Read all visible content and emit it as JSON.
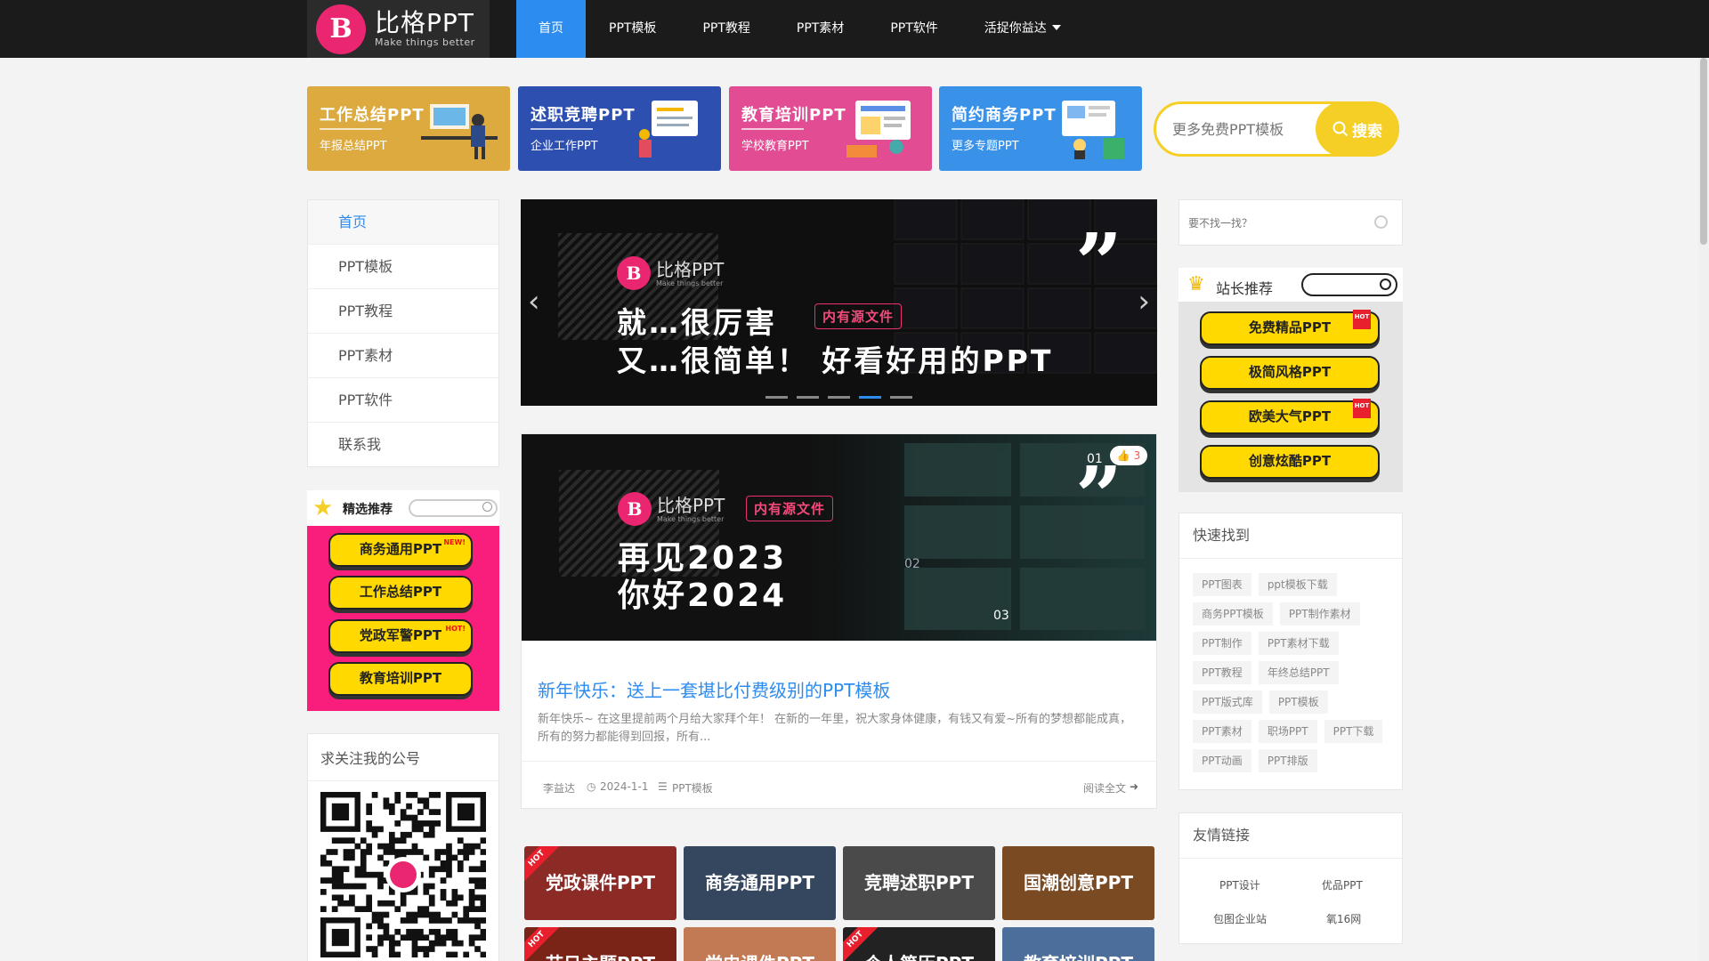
{
  "logo": {
    "name": "比格PPT",
    "tagline": "Make things better",
    "mark": "B"
  },
  "nav": [
    {
      "label": "首页"
    },
    {
      "label": "PPT模板"
    },
    {
      "label": "PPT教程"
    },
    {
      "label": "PPT素材"
    },
    {
      "label": "PPT软件"
    },
    {
      "label": "活捉你益达"
    }
  ],
  "categories": [
    {
      "title": "工作总结PPT",
      "sub": "年报总结PPT",
      "color": "#dcaa3f"
    },
    {
      "title": "述职竞聘PPT",
      "sub": "企业工作PPT",
      "color": "#2d4fb0"
    },
    {
      "title": "教育培训PPT",
      "sub": "学校教育PPT",
      "color": "#e24c93"
    },
    {
      "title": "简约商务PPT",
      "sub": "更多专题PPT",
      "color": "#3a91e8"
    }
  ],
  "search": {
    "placeholder": "更多免费PPT模板",
    "button": "搜索"
  },
  "side_menu": [
    {
      "label": "首页"
    },
    {
      "label": "PPT模板"
    },
    {
      "label": "PPT教程"
    },
    {
      "label": "PPT素材"
    },
    {
      "label": "PPT软件"
    },
    {
      "label": "联系我"
    }
  ],
  "picks": {
    "title": "精选推荐",
    "items": [
      {
        "label": "商务通用PPT",
        "badge": "NEW!"
      },
      {
        "label": "工作总结PPT",
        "badge": ""
      },
      {
        "label": "党政军警PPT",
        "badge": "HOT!"
      },
      {
        "label": "教育培训PPT",
        "badge": ""
      }
    ]
  },
  "qr": {
    "title": "求关注我的公号"
  },
  "hero": {
    "brand": "比格PPT",
    "brand_sub": "Make things better",
    "tag": "内有源文件",
    "line1": "就…很厉害",
    "line2": "又…很简单！ 好看好用的PPT",
    "slides": 5,
    "active_slide": 4
  },
  "post": {
    "brand": "比格PPT",
    "brand_sub": "Make things better",
    "tag": "内有源文件",
    "line1": "再见2023",
    "line2": "你好2024",
    "likes": "3",
    "num1": "01",
    "num2": "02",
    "num3": "03",
    "title": "新年快乐：送上一套堪比付费级别的PPT模板",
    "excerpt": "新年快乐~ 在这里提前两个月给大家拜个年！ 在新的一年里，祝大家身体健康，有钱又有爱~所有的梦想都能成真，所有的努力都能得到回报，所有...",
    "author": "李益达",
    "date": "2024-1-1",
    "category": "PPT模板",
    "read_more": "阅读全文"
  },
  "thumbs": [
    {
      "label": "党政课件PPT",
      "hot": true,
      "color": "#8c2b26"
    },
    {
      "label": "商务通用PPT",
      "hot": false,
      "color": "#35475e"
    },
    {
      "label": "竞聘述职PPT",
      "hot": false,
      "color": "#4a4a4a"
    },
    {
      "label": "国潮创意PPT",
      "hot": false,
      "color": "#7a4a22"
    },
    {
      "label": "节日主题PPT",
      "hot": true,
      "color": "#7a2418"
    },
    {
      "label": "党史课件PPT",
      "hot": false,
      "color": "#c27a55"
    },
    {
      "label": "个人简历PPT",
      "hot": true,
      "color": "#222222"
    },
    {
      "label": "教育培训PPT",
      "hot": false,
      "color": "#4b6f9a"
    }
  ],
  "right_search": {
    "placeholder": "要不找一找？"
  },
  "recommend": {
    "title": "站长推荐",
    "items": [
      {
        "label": "免费精品PPT",
        "hot": true
      },
      {
        "label": "极简风格PPT",
        "hot": false
      },
      {
        "label": "欧美大气PPT",
        "hot": true
      },
      {
        "label": "创意炫酷PPT",
        "hot": false
      }
    ]
  },
  "quick": {
    "title": "快速找到",
    "tags": [
      "PPT图表",
      "ppt模板下载",
      "商务PPT模板",
      "PPT制作素材",
      "PPT制作",
      "PPT素材下载",
      "PPT教程",
      "年终总结PPT",
      "PPT版式库",
      "PPT模板",
      "PPT素材",
      "职场PPT",
      "PPT下载",
      "PPT动画",
      "PPT排版"
    ]
  },
  "links": {
    "title": "友情链接",
    "items": [
      "PPT设计",
      "优品PPT",
      "包图企业站",
      "氧16网"
    ]
  },
  "hot_label": "HOT",
  "colors": {
    "accent": "#2d8cf0",
    "yellow": "#ffd900",
    "pink": "#f91e7c",
    "brand": "#e9266f"
  }
}
